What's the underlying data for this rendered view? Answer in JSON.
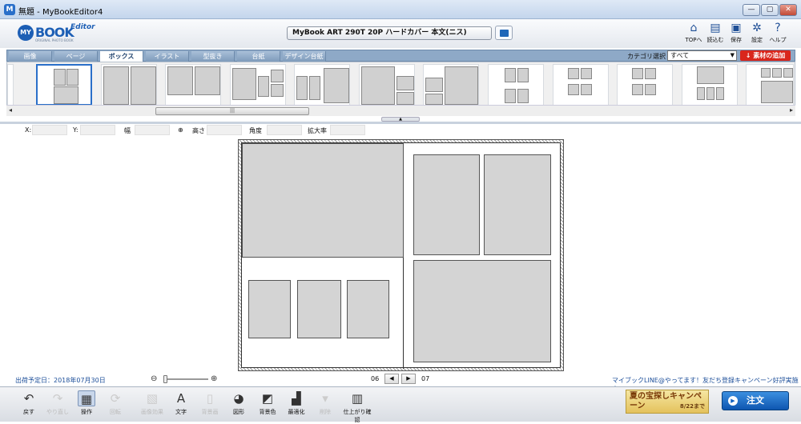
{
  "window": {
    "title": "無題 - MyBookEditor4",
    "app_icon": "M"
  },
  "logo": {
    "my": "MY",
    "book": "BOOK",
    "editor": "Editor",
    "sub": "ORIGINAL PHOTO BOOK"
  },
  "product": {
    "name": "MyBook ART 290T 20P ハードカバー 本文(ニス)"
  },
  "header_buttons": [
    {
      "label": "TOPへ",
      "icon": "home-icon",
      "glyph": "⌂"
    },
    {
      "label": "読込む",
      "icon": "open-icon",
      "glyph": "▤"
    },
    {
      "label": "保存",
      "icon": "save-icon",
      "glyph": "▣"
    },
    {
      "label": "設定",
      "icon": "gear-icon",
      "glyph": "✲"
    },
    {
      "label": "ヘルプ",
      "icon": "help-icon",
      "glyph": "?"
    }
  ],
  "tabs": [
    {
      "label": "画像",
      "active": false
    },
    {
      "label": "ページ",
      "active": false
    },
    {
      "label": "ボックス",
      "active": true
    },
    {
      "label": "イラスト",
      "active": false
    },
    {
      "label": "型抜き",
      "active": false
    },
    {
      "label": "台紙",
      "active": false
    },
    {
      "label": "デザイン台紙",
      "active": false
    }
  ],
  "category": {
    "label": "カテゴリ選択",
    "value": "すべて"
  },
  "add_material": {
    "label": "素材の追加"
  },
  "properties": {
    "x": "X:",
    "y": "Y:",
    "width": "幅",
    "height": "高さ",
    "angle": "角度",
    "scale": "拡大率"
  },
  "pager": {
    "left": "06",
    "right": "07"
  },
  "ship_date": "出荷予定日：2018年07月30日",
  "promo": "マイブックLINE@やってます！友だち登録キャンペーン好評実施中♪",
  "toolbar": [
    {
      "label": "戻す",
      "icon": "undo-icon",
      "glyph": "↶",
      "state": "normal"
    },
    {
      "label": "やり直し",
      "icon": "redo-icon",
      "glyph": "↷",
      "state": "disabled"
    },
    {
      "label": "操作",
      "icon": "operate-icon",
      "glyph": "▦",
      "state": "active"
    },
    {
      "label": "回転",
      "icon": "rotate-icon",
      "glyph": "⟳",
      "state": "disabled"
    },
    {
      "label": "画像効果",
      "icon": "image-effect-icon",
      "glyph": "▧",
      "state": "disabled"
    },
    {
      "label": "文字",
      "icon": "text-icon",
      "glyph": "A",
      "state": "normal"
    },
    {
      "label": "背景画",
      "icon": "background-image-icon",
      "glyph": "▯",
      "state": "disabled"
    },
    {
      "label": "図形",
      "icon": "shape-icon",
      "glyph": "◕",
      "state": "normal"
    },
    {
      "label": "背景色",
      "icon": "background-color-icon",
      "glyph": "◩",
      "state": "normal"
    },
    {
      "label": "最適化",
      "icon": "optimize-icon",
      "glyph": "▟",
      "state": "normal"
    },
    {
      "label": "削除",
      "icon": "trash-icon",
      "glyph": "▾",
      "state": "disabled"
    },
    {
      "label": "仕上がり確認",
      "icon": "preview-book-icon",
      "glyph": "▥",
      "state": "normal"
    }
  ],
  "campaign": {
    "title": "夏の宝探しキャンペーン",
    "date": "8/22まで"
  },
  "order": {
    "label": "注文"
  }
}
